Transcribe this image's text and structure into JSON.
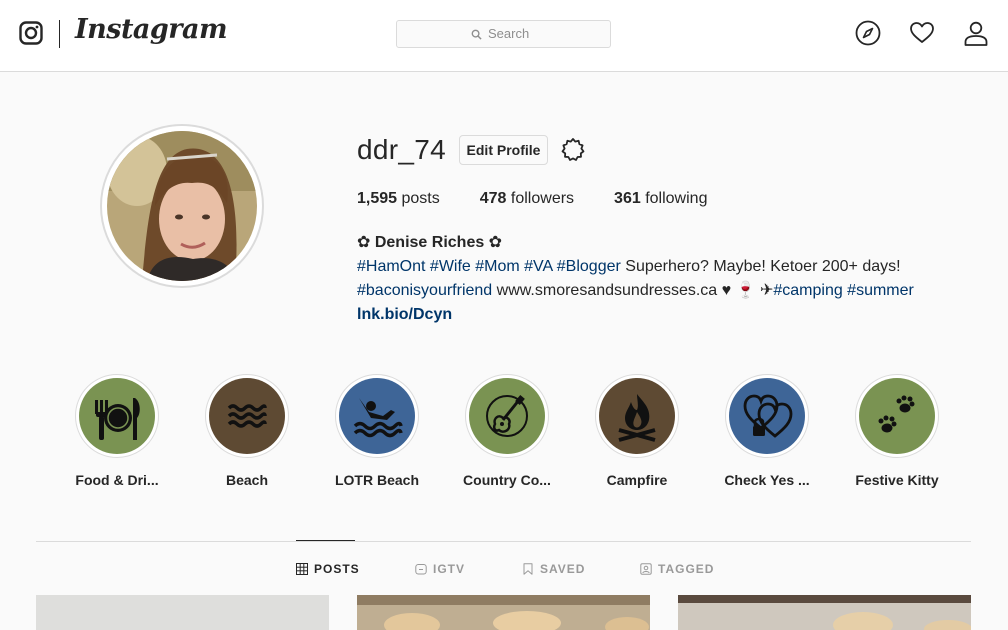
{
  "header": {
    "wordmark": "Instagram",
    "search_placeholder": "Search",
    "icons": [
      "instagram-glyph-icon",
      "search-icon",
      "compass-icon",
      "heart-icon",
      "user-icon"
    ]
  },
  "profile": {
    "username": "ddr_74",
    "edit_label": "Edit Profile",
    "stats": [
      {
        "count": "1,595",
        "label": "posts"
      },
      {
        "count": "478",
        "label": "followers"
      },
      {
        "count": "361",
        "label": "following"
      }
    ],
    "bio": {
      "name": "✿ Denise Riches ✿",
      "line1_tags": "#HamOnt #Wife #Mom #VA #Blogger",
      "line1_text": " Superhero? Maybe! Ketoer 200+ days!",
      "line2_tag": "#baconisyourfriend",
      "line2_text": " www.smoresandsundresses.ca ♥ 🍷 ✈",
      "line2_tags_end": "#camping #summer",
      "link": "lnk.bio/Dcyn"
    }
  },
  "highlights": [
    {
      "label": "Food & Dri...",
      "color": "#7a9352",
      "icon": "plate-cutlery-icon"
    },
    {
      "label": "Beach",
      "color": "#5e4a33",
      "icon": "waves-icon"
    },
    {
      "label": "LOTR Beach",
      "color": "#3e6597",
      "icon": "swimmer-icon"
    },
    {
      "label": "Country Co...",
      "color": "#7a9352",
      "icon": "guitar-icon"
    },
    {
      "label": "Campfire",
      "color": "#5e4a33",
      "icon": "campfire-icon"
    },
    {
      "label": "Check Yes ...",
      "color": "#3e6597",
      "icon": "hearts-lock-icon"
    },
    {
      "label": "Festive Kitty",
      "color": "#7a9352",
      "icon": "paw-prints-icon"
    }
  ],
  "tabs": [
    {
      "label": "POSTS",
      "icon": "grid-icon",
      "active": true
    },
    {
      "label": "IGTV",
      "icon": "igtv-icon",
      "active": false
    },
    {
      "label": "SAVED",
      "icon": "bookmark-icon",
      "active": false
    },
    {
      "label": "TAGGED",
      "icon": "tag-person-icon",
      "active": false
    }
  ]
}
